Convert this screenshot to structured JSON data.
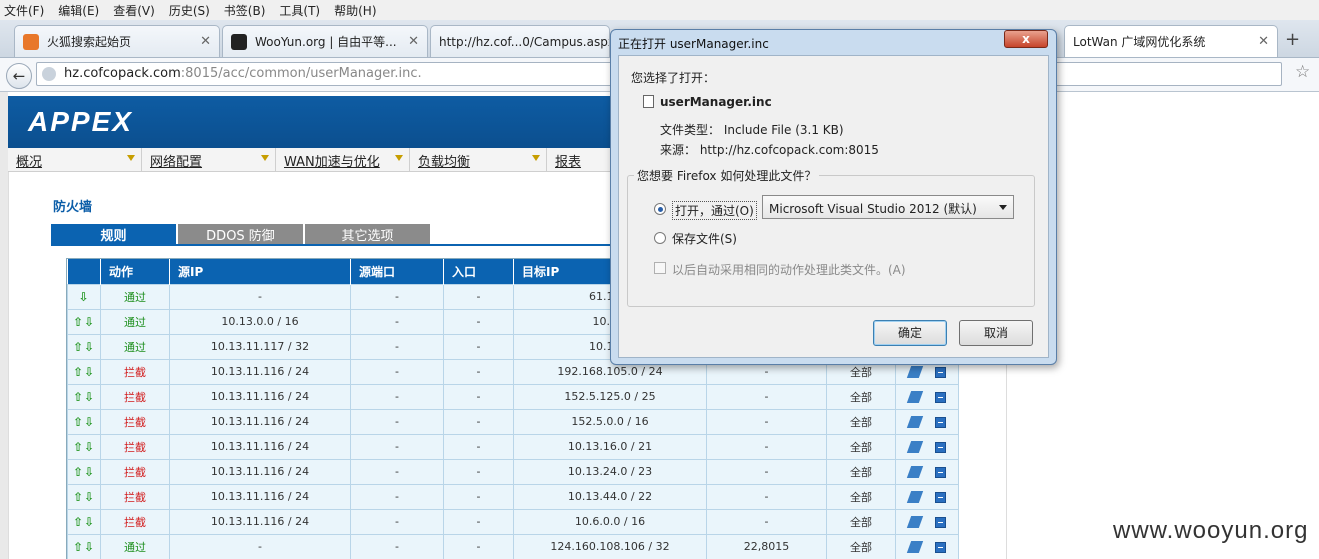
{
  "menubar": {
    "items": [
      "文件(F)",
      "编辑(E)",
      "查看(V)",
      "历史(S)",
      "书签(B)",
      "工具(T)",
      "帮助(H)"
    ]
  },
  "tabs": [
    {
      "title": "火狐搜索起始页"
    },
    {
      "title": "WooYun.org | 自由平等..."
    },
    {
      "title": "http://hz.cof...0/Campus.aspx"
    },
    {
      "title": "LotWan 广域网优化系统"
    }
  ],
  "url": {
    "host": "hz.cofcopack.com",
    "rest": ":8015/acc/common/userManager.inc."
  },
  "page": {
    "logo": "APPEX",
    "menu": [
      "概况",
      "网络配置",
      "WAN加速与优化",
      "负载均衡",
      "报表"
    ],
    "title": "防火墙",
    "tabs": [
      "规则",
      "DDOS 防御",
      "其它选项"
    ],
    "table": {
      "headers": [
        "",
        "动作",
        "源IP",
        "源端口",
        "入口",
        "目标IP",
        "",
        "",
        ""
      ],
      "rows": [
        {
          "arrows": "⇩",
          "action": "通过",
          "type": "pass",
          "src": "-",
          "sport": "-",
          "in": "-",
          "dst": "61.130.",
          "dport": "",
          "all": "",
          "ops": false
        },
        {
          "arrows": "⇧⇩",
          "action": "通过",
          "type": "pass",
          "src": "10.13.0.0 / 16",
          "sport": "-",
          "in": "-",
          "dst": "10.13.",
          "dport": "",
          "all": "",
          "ops": false
        },
        {
          "arrows": "⇧⇩",
          "action": "通过",
          "type": "pass",
          "src": "10.13.11.117 / 32",
          "sport": "-",
          "in": "-",
          "dst": "10.13.1",
          "dport": "",
          "all": "",
          "ops": false
        },
        {
          "arrows": "⇧⇩",
          "action": "拦截",
          "type": "block",
          "src": "10.13.11.116 / 24",
          "sport": "-",
          "in": "-",
          "dst": "192.168.105.0 / 24",
          "dport": "-",
          "all": "全部",
          "ops": true
        },
        {
          "arrows": "⇧⇩",
          "action": "拦截",
          "type": "block",
          "src": "10.13.11.116 / 24",
          "sport": "-",
          "in": "-",
          "dst": "152.5.125.0 / 25",
          "dport": "-",
          "all": "全部",
          "ops": true
        },
        {
          "arrows": "⇧⇩",
          "action": "拦截",
          "type": "block",
          "src": "10.13.11.116 / 24",
          "sport": "-",
          "in": "-",
          "dst": "152.5.0.0 / 16",
          "dport": "-",
          "all": "全部",
          "ops": true
        },
        {
          "arrows": "⇧⇩",
          "action": "拦截",
          "type": "block",
          "src": "10.13.11.116 / 24",
          "sport": "-",
          "in": "-",
          "dst": "10.13.16.0 / 21",
          "dport": "-",
          "all": "全部",
          "ops": true
        },
        {
          "arrows": "⇧⇩",
          "action": "拦截",
          "type": "block",
          "src": "10.13.11.116 / 24",
          "sport": "-",
          "in": "-",
          "dst": "10.13.24.0 / 23",
          "dport": "-",
          "all": "全部",
          "ops": true
        },
        {
          "arrows": "⇧⇩",
          "action": "拦截",
          "type": "block",
          "src": "10.13.11.116 / 24",
          "sport": "-",
          "in": "-",
          "dst": "10.13.44.0 / 22",
          "dport": "-",
          "all": "全部",
          "ops": true
        },
        {
          "arrows": "⇧⇩",
          "action": "拦截",
          "type": "block",
          "src": "10.13.11.116 / 24",
          "sport": "-",
          "in": "-",
          "dst": "10.6.0.0 / 16",
          "dport": "-",
          "all": "全部",
          "ops": true
        },
        {
          "arrows": "⇧⇩",
          "action": "通过",
          "type": "pass",
          "src": "-",
          "sport": "-",
          "in": "-",
          "dst": "124.160.108.106 / 32",
          "dport": "22,8015",
          "all": "全部",
          "ops": true
        }
      ]
    }
  },
  "dialog": {
    "title": "正在打开 userManager.inc",
    "close": "x",
    "chose": "您选择了打开：",
    "filename": "userManager.inc",
    "filetype": "文件类型： Include File (3.1 KB)",
    "source": "来源： http://hz.cofcopack.com:8015",
    "question": "您想要 Firefox 如何处理此文件？",
    "open_with": "打开，通过(O)",
    "app": "Microsoft Visual Studio 2012 (默认)",
    "save": "保存文件(S)",
    "auto": "以后自动采用相同的动作处理此类文件。(A)",
    "ok": "确定",
    "cancel": "取消"
  },
  "watermark": "www.wooyun.org",
  "colors": {
    "accent": "#0b63b1",
    "pass": "#1d8f1d",
    "block": "#d21a1a"
  }
}
